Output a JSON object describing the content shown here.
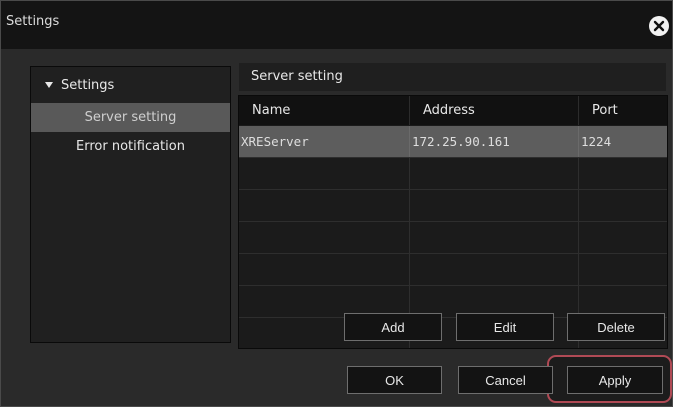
{
  "window": {
    "title": "Settings"
  },
  "tree": {
    "root_label": "Settings",
    "items": [
      {
        "label": "Server setting",
        "selected": true
      },
      {
        "label": "Error notification",
        "selected": false
      }
    ]
  },
  "panel": {
    "title": "Server setting",
    "columns": [
      "Name",
      "Address",
      "Port"
    ],
    "rows": [
      {
        "name": "XREServer",
        "address": "172.25.90.161",
        "port": "1224"
      }
    ]
  },
  "buttons": {
    "add": "Add",
    "edit": "Edit",
    "delete": "Delete",
    "ok": "OK",
    "cancel": "Cancel",
    "apply": "Apply"
  },
  "colors": {
    "background": "#2a2a2a",
    "selection": "#595959",
    "focus_ring": "#b04a55"
  }
}
